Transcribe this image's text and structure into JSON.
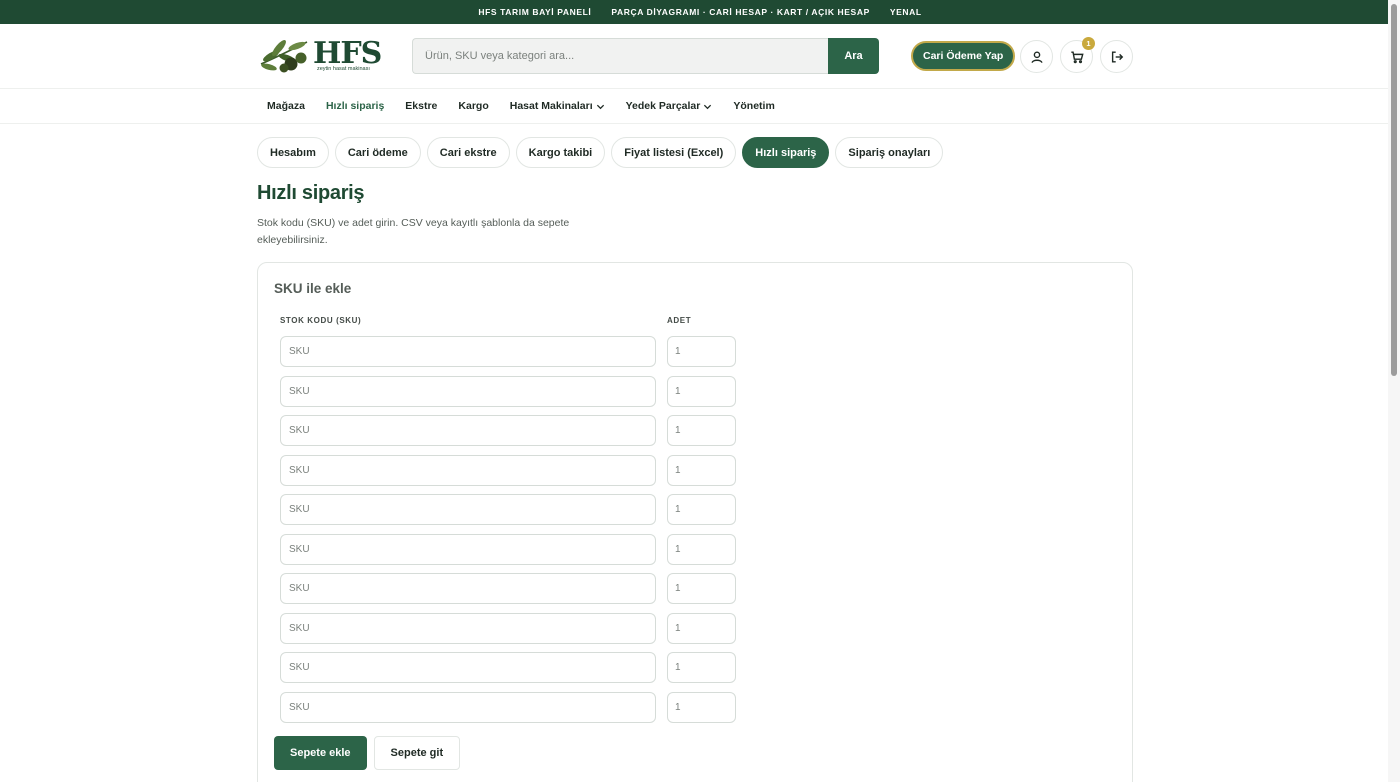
{
  "topbar": {
    "items": [
      "HFS TARIM BAYİ PANELİ",
      "PARÇA DİYAGRAMI · CARİ HESAP · KART / AÇIK HESAP",
      "YENAL"
    ]
  },
  "header": {
    "logo_word": "HFS",
    "logo_sub": "zeytin hasat makinası",
    "search_placeholder": "Ürün, SKU veya kategori ara...",
    "search_button": "Ara",
    "pay_button": "Cari Ödeme Yap",
    "cart_count": "1",
    "icons": [
      "user-icon",
      "cart-icon",
      "logout-icon"
    ]
  },
  "nav": {
    "items": [
      {
        "label": "Mağaza",
        "dropdown": false
      },
      {
        "label": "Hızlı sipariş",
        "dropdown": false,
        "active": true
      },
      {
        "label": "Ekstre",
        "dropdown": false
      },
      {
        "label": "Kargo",
        "dropdown": false
      },
      {
        "label": "Hasat Makinaları",
        "dropdown": true
      },
      {
        "label": "Yedek Parçalar",
        "dropdown": true
      },
      {
        "label": "Yönetim",
        "dropdown": false
      }
    ]
  },
  "tabs": [
    {
      "label": "Hesabım"
    },
    {
      "label": "Cari ödeme"
    },
    {
      "label": "Cari ekstre"
    },
    {
      "label": "Kargo takibi"
    },
    {
      "label": "Fiyat listesi (Excel)"
    },
    {
      "label": "Hızlı sipariş",
      "active": true
    },
    {
      "label": "Sipariş onayları"
    }
  ],
  "page": {
    "title": "Hızlı sipariş",
    "description": "Stok kodu (SKU) ve adet girin. CSV veya kayıtlı şablonla da sepete ekleyebilirsiniz."
  },
  "form": {
    "title": "SKU ile ekle",
    "sku_header": "STOK KODU (SKU)",
    "qty_header": "ADET",
    "sku_placeholder": "SKU",
    "rows": [
      {
        "sku": "",
        "qty": "1"
      },
      {
        "sku": "",
        "qty": "1"
      },
      {
        "sku": "",
        "qty": "1"
      },
      {
        "sku": "",
        "qty": "1"
      },
      {
        "sku": "",
        "qty": "1"
      },
      {
        "sku": "",
        "qty": "1"
      },
      {
        "sku": "",
        "qty": "1"
      },
      {
        "sku": "",
        "qty": "1"
      },
      {
        "sku": "",
        "qty": "1"
      },
      {
        "sku": "",
        "qty": "1"
      }
    ],
    "add_button": "Sepete ekle",
    "go_button": "Sepete git"
  },
  "colors": {
    "brand_dark": "#1f4a33",
    "brand": "#2c6448",
    "accent_gold": "#c9a93d"
  }
}
